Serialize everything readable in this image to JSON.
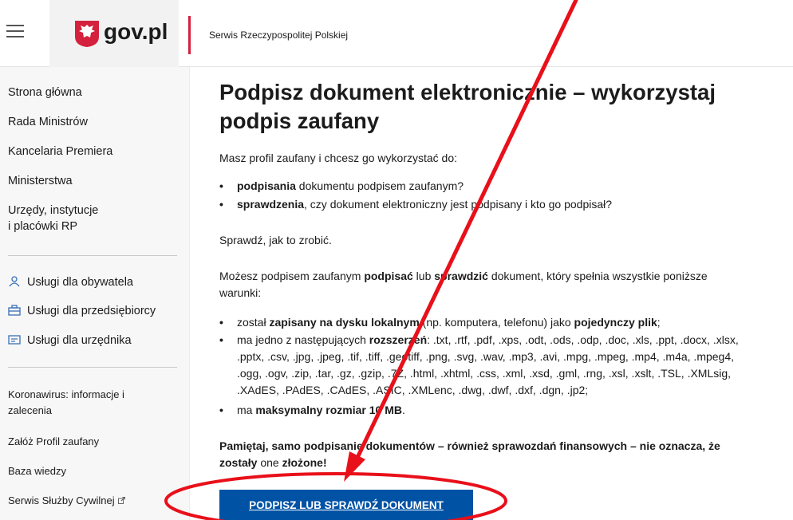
{
  "header": {
    "logo_text": "gov.pl",
    "subtitle": "Serwis Rzeczypospolitej Polskiej"
  },
  "sidebar": {
    "primary": [
      "Strona główna",
      "Rada Ministrów",
      "Kancelaria Premiera",
      "Ministerstwa",
      "Urzędy, instytucje",
      "i placówki RP"
    ],
    "services": [
      {
        "label": "Usługi dla obywatela",
        "icon": "person-icon"
      },
      {
        "label": "Usługi dla przedsiębiorcy",
        "icon": "briefcase-icon"
      },
      {
        "label": "Usługi dla urzędnika",
        "icon": "id-card-icon"
      }
    ],
    "secondary": [
      "Koronawirus: informacje i",
      "zalecenia",
      "Załóż Profil zaufany",
      "Baza wiedzy",
      "Serwis Służby Cywilnej"
    ]
  },
  "main": {
    "title_line1": "Podpisz dokument elektronicznie – wykorzystaj",
    "title_line2": "podpis zaufany",
    "intro": "Masz profil zaufany i chcesz go wykorzystać do:",
    "list1": {
      "item1_bold": "podpisania",
      "item1_rest": " dokumentu podpisem zaufanym?",
      "item2_bold": "sprawdzenia",
      "item2_rest": ", czy dokument elektroniczny jest podpisany i kto go podpisał?"
    },
    "check": "Sprawdź, jak to zrobić.",
    "cond": {
      "a": "Możesz podpisem zaufanym ",
      "b": "podpisać",
      "c": " lub ",
      "d": "sprawdzić",
      "e": " dokument, który spełnia wszystkie poniższe",
      "line2": "warunki:"
    },
    "list2": {
      "i1a": "został ",
      "i1b": "zapisany na dysku lokalnym",
      "i1c": " (np. komputera, telefonu) jako ",
      "i1d": "pojedynczy plik",
      "i1e": ";",
      "i2a": "ma jedno z następujących ",
      "i2b": "rozszerzeń",
      "i2c": ": .txt, .rtf, .pdf, .xps, .odt, .ods, .odp, .doc, .xls, .ppt, .docx, .xlsx,",
      "i2l2": ".pptx, .csv, .jpg, .jpeg, .tif, .tiff, .geotiff, .png, .svg, .wav, .mp3, .avi, .mpg, .mpeg, .mp4, .m4a, .mpeg4,",
      "i2l3": ".ogg, .ogv, .zip, .tar, .gz, .gzip, .7Z, .html, .xhtml, .css, .xml, .xsd, .gml, .rng, .xsl, .xslt, .TSL, .XMLsig,",
      "i2l4": ".XAdES, .PAdES, .CAdES, .ASIC, .XMLenc, .dwg, .dwf, .dxf, .dgn, .jp2;",
      "i3a": "ma ",
      "i3b": "maksymalny rozmiar 10 MB",
      "i3c": "."
    },
    "remember_line1": "Pamiętaj, samo podpisanie dokumentów – również sprawozdań finansowych – nie oznacza, że",
    "remember_line2a": "zostały",
    "remember_line2b": " one ",
    "remember_line2c": "złożone!",
    "cta": "PODPISZ LUB SPRAWDŹ DOKUMENT"
  },
  "colors": {
    "accent_red": "#d4213d",
    "button_blue": "#0052a5",
    "annotation_red": "#e8101a"
  }
}
